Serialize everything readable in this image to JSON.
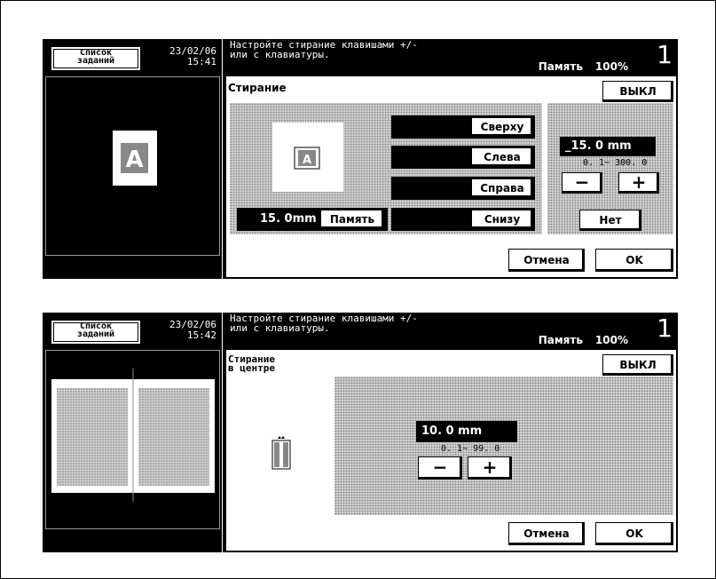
{
  "screen1": {
    "list_button": [
      "Список",
      "заданий"
    ],
    "date": "23/02/06",
    "time": "15:41",
    "message": [
      "Настройте стирание клавишами +/-",
      "или с клавиатуры."
    ],
    "memory_label": "Память",
    "memory_value": "100%",
    "page_number": "1",
    "title": "Стирание",
    "off_button": "ВЫКЛ",
    "preview_letter": "A",
    "width_value": "15. 0mm",
    "memory_button": "Память",
    "sides": [
      "Сверху",
      "Слева",
      "Справа",
      "Снизу"
    ],
    "input_value": "_15. 0 mm",
    "range": "0. 1~  300. 0",
    "minus": "−",
    "plus": "+",
    "no_button": "Нет",
    "cancel_button": "Отмена",
    "ok_button": "OK"
  },
  "screen2": {
    "list_button": [
      "Список",
      "заданий"
    ],
    "date": "23/02/06",
    "time": "15:42",
    "message": [
      "Настройте стирание клавишами +/-",
      "или с клавиатуры."
    ],
    "memory_label": "Память",
    "memory_value": "100%",
    "page_number": "1",
    "title": [
      "Стирание",
      "в центре"
    ],
    "off_button": "ВЫКЛ",
    "input_value": "10. 0  mm",
    "range": "0. 1~  99. 0",
    "minus": "−",
    "plus": "+",
    "cancel_button": "Отмена",
    "ok_button": "OK"
  }
}
